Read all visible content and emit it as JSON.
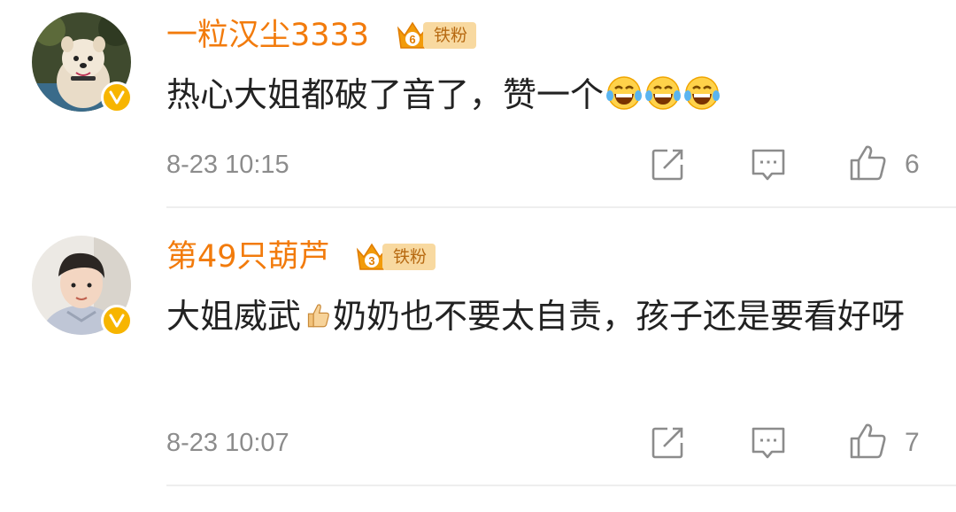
{
  "comments": [
    {
      "username": "一粒汉尘3333",
      "fan_level": "6",
      "fan_label": "铁粉",
      "text": "热心大姐都破了音了，赞一个",
      "emojis": [
        "laughing-tears-emoji",
        "laughing-tears-emoji",
        "laughing-tears-emoji"
      ],
      "time": "8-23 10:15",
      "likes": "6",
      "verified_icon": "verified-v-icon"
    },
    {
      "username": "第49只葫芦",
      "fan_level": "3",
      "fan_label": "铁粉",
      "text_before_emoji": "大姐威武",
      "emoji": "thumbs-up-emoji",
      "text_after_emoji": "奶奶也不要太自责，孩子还是要看好呀",
      "time": "8-23 10:07",
      "likes": "7",
      "verified_icon": "verified-v-icon"
    }
  ],
  "colors": {
    "username": "#f27b0c",
    "badge_gold": "#f7b500",
    "fan_plate": "#f8d9a0",
    "text": "#222222",
    "meta": "#8c8c8c"
  }
}
